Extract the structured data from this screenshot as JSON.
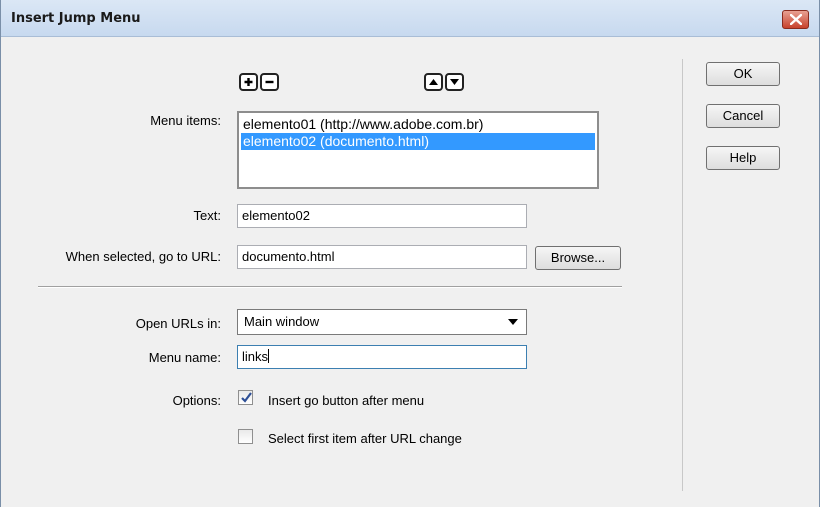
{
  "window": {
    "title": "Insert Jump Menu"
  },
  "menu_items": {
    "label": "Menu items:",
    "items": [
      {
        "text": "elemento01 (http://www.adobe.com.br)",
        "selected": false
      },
      {
        "text": "elemento02 (documento.html)",
        "selected": true
      }
    ],
    "add_icon": "plus-icon",
    "remove_icon": "minus-icon",
    "move_up_icon": "triangle-up-icon",
    "move_down_icon": "triangle-down-icon"
  },
  "text_field": {
    "label": "Text:",
    "value": "elemento02"
  },
  "url_field": {
    "label": "When selected, go to URL:",
    "value": "documento.html",
    "browse_label": "Browse..."
  },
  "open_urls_in": {
    "label": "Open URLs in:",
    "selected": "Main window"
  },
  "menu_name": {
    "label": "Menu name:",
    "value": "links"
  },
  "options": {
    "label": "Options:",
    "insert_go_button": {
      "label": "Insert go button after menu",
      "checked": true
    },
    "select_first_item": {
      "label": "Select first item after URL change",
      "checked": false
    }
  },
  "buttons": {
    "ok": "OK",
    "cancel": "Cancel",
    "help": "Help"
  },
  "colors": {
    "selection": "#3399ff",
    "dialog_bg": "#f0f0f0",
    "close_button": "#c7422d"
  }
}
